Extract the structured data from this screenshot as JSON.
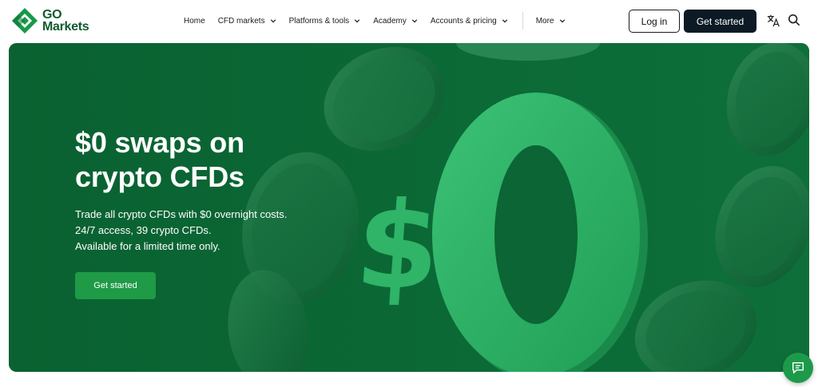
{
  "brand": {
    "logo_line1": "GO",
    "logo_line2": "Markets",
    "color_primary": "#0f5a2e",
    "color_accent": "#1f9a46"
  },
  "nav": {
    "items": [
      {
        "label": "Home",
        "has_dropdown": false
      },
      {
        "label": "CFD markets",
        "has_dropdown": true
      },
      {
        "label": "Platforms & tools",
        "has_dropdown": true
      },
      {
        "label": "Academy",
        "has_dropdown": true
      },
      {
        "label": "Accounts & pricing",
        "has_dropdown": true
      },
      {
        "label": "More",
        "has_dropdown": true
      }
    ],
    "login_label": "Log in",
    "get_started_label": "Get started",
    "language_icon": "translate-icon",
    "search_icon": "search-icon"
  },
  "hero": {
    "title_line1": "$0 swaps on",
    "title_line2": "crypto CFDs",
    "subtitle_line1": "Trade all crypto CFDs with $0 overnight costs.",
    "subtitle_line2": "24/7 access, 39 crypto CFDs.",
    "subtitle_line3": "Available for a limited time only.",
    "cta_label": "Get started",
    "big_dollar": "$",
    "big_zero": "0",
    "background_color": "#0b6534"
  },
  "chat": {
    "icon": "chat-icon"
  }
}
